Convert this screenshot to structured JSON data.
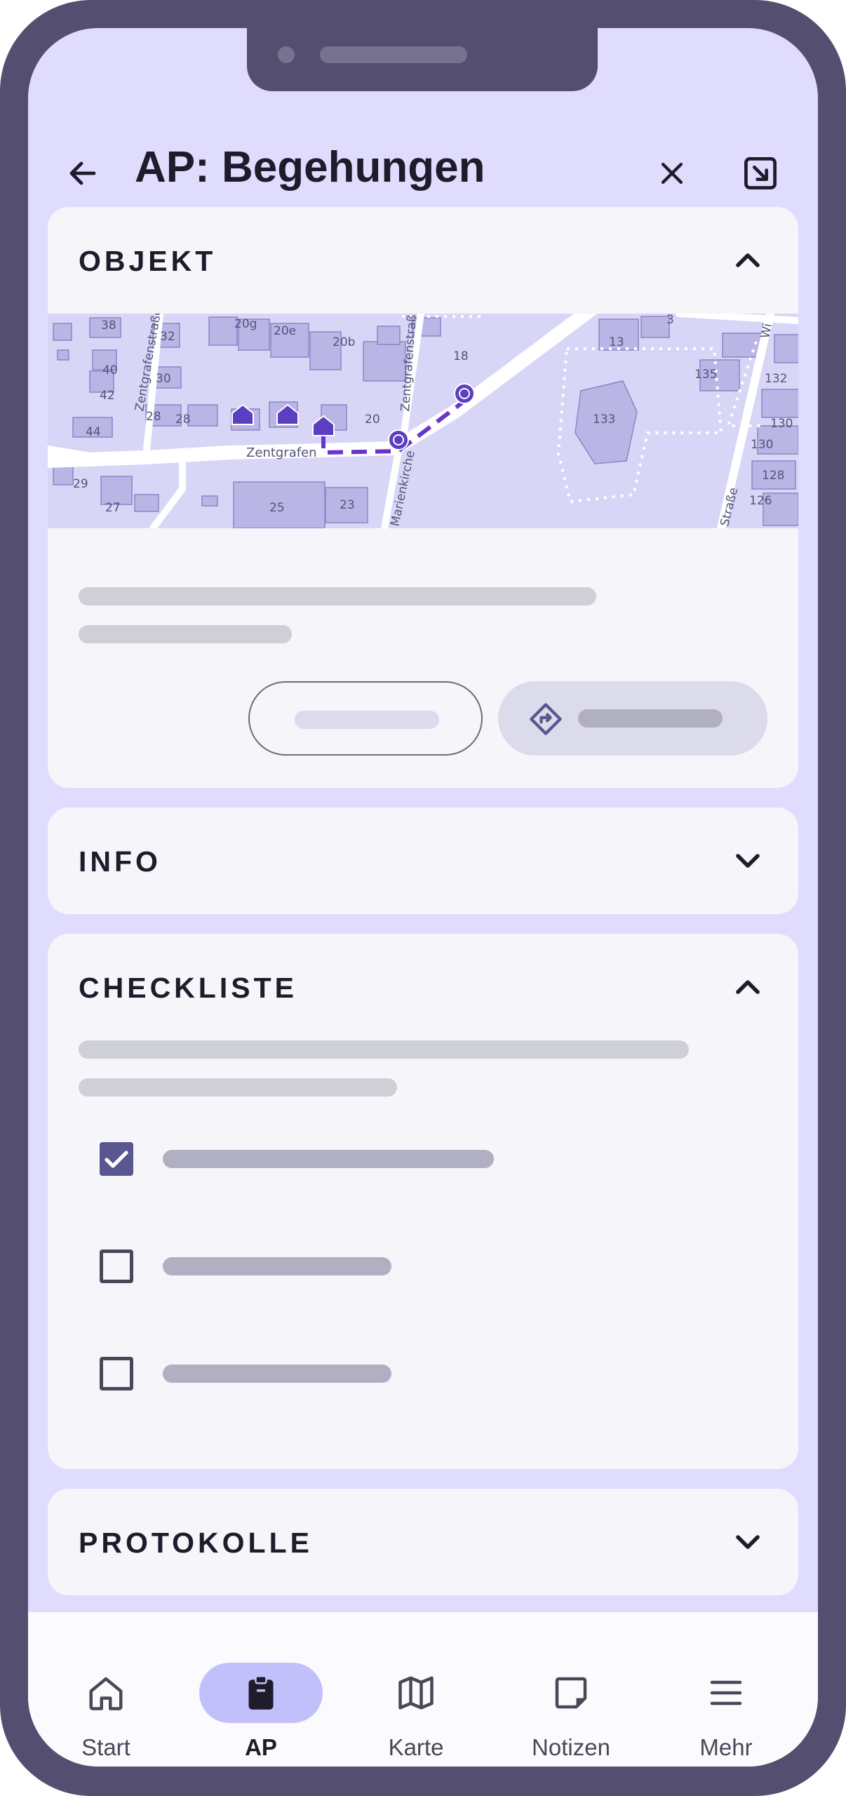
{
  "header": {
    "title": "AP: Begehungen",
    "back_icon": "arrow-left-icon",
    "close_icon": "close-icon",
    "minimize_icon": "arrow-down-right-box-icon"
  },
  "sections": {
    "objekt": {
      "title": "OBJEKT",
      "expanded": true
    },
    "info": {
      "title": "INFO",
      "expanded": false
    },
    "checkliste": {
      "title": "CHECKLISTE",
      "expanded": true
    },
    "protokolle": {
      "title": "PROTOKOLLE",
      "expanded": false
    }
  },
  "map": {
    "street_labels": [
      "Zentgrafen",
      "Zentgrafenstraße",
      "Zentgrafenstraß",
      "Marienkirche",
      "Straße",
      "Wi"
    ],
    "house_numbers": [
      "38",
      "32",
      "20g",
      "20e",
      "20b",
      "40",
      "30",
      "18",
      "13",
      "3",
      "135",
      "132",
      "42",
      "28",
      "28",
      "20",
      "133",
      "130",
      "44",
      "130",
      "29",
      "25",
      "23",
      "128",
      "27",
      "126"
    ],
    "route_color": "#6b35c9",
    "marker_color": "#5a3fc0"
  },
  "checklist": {
    "items": [
      {
        "checked": true
      },
      {
        "checked": false
      },
      {
        "checked": false
      }
    ]
  },
  "bottom_nav": {
    "items": [
      {
        "label": "Start",
        "icon": "home-icon",
        "active": false
      },
      {
        "label": "AP",
        "icon": "clipboard-icon",
        "active": true
      },
      {
        "label": "Karte",
        "icon": "map-icon",
        "active": false
      },
      {
        "label": "Notizen",
        "icon": "sticky-note-icon",
        "active": false
      },
      {
        "label": "Mehr",
        "icon": "menu-icon",
        "active": false
      }
    ]
  },
  "colors": {
    "background": "#e0dcfe",
    "frame": "#544f70",
    "card": "#f5f5fa",
    "accent": "#5a5690",
    "active_pill": "#c2c0fb"
  }
}
